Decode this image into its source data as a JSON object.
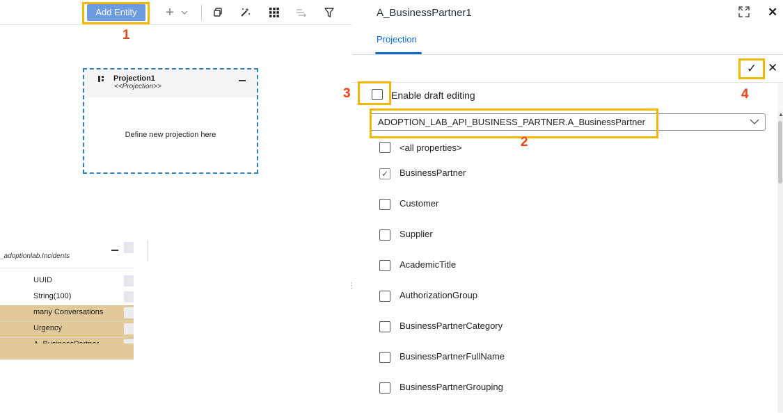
{
  "toolbar": {
    "add_entity_label": "Add Entity",
    "icons": [
      "plus-icon",
      "chevron-down-icon",
      "copy-icon",
      "magic-wand-icon",
      "grid-icon",
      "route-icon",
      "filter-icon"
    ]
  },
  "projection_node": {
    "title": "Projection1",
    "stereotype": "<<Projection>>",
    "placeholder": "Define new projection here"
  },
  "entity_node": {
    "title": "_adoptionlab.Incidents",
    "rows": [
      {
        "label": "UUID"
      },
      {
        "label": "String(100)"
      },
      {
        "label": "many Conversations"
      },
      {
        "label": "Urgency"
      },
      {
        "label": "A_BusinessPartner"
      }
    ]
  },
  "panel": {
    "title": "A_BusinessPartner1",
    "tab_label": "Projection",
    "confirm_symbol": "✓",
    "cancel_symbol": "✕",
    "close_symbol": "✕"
  },
  "form": {
    "draft_label": "Enable draft editing",
    "draft_checked": false,
    "selected_entity": "ADOPTION_LAB_API_BUSINESS_PARTNER.A_BusinessPartner",
    "properties": [
      {
        "label": "<all properties>",
        "checked": false
      },
      {
        "label": "BusinessPartner",
        "checked": true
      },
      {
        "label": "Customer",
        "checked": false
      },
      {
        "label": "Supplier",
        "checked": false
      },
      {
        "label": "AcademicTitle",
        "checked": false
      },
      {
        "label": "AuthorizationGroup",
        "checked": false
      },
      {
        "label": "BusinessPartnerCategory",
        "checked": false
      },
      {
        "label": "BusinessPartnerFullName",
        "checked": false
      },
      {
        "label": "BusinessPartnerGrouping",
        "checked": false
      }
    ]
  },
  "annotations": {
    "step1": "1",
    "step2": "2",
    "step3": "3",
    "step4": "4"
  },
  "colors": {
    "highlight_frame": "#f2b705",
    "step_marker": "#e8471b",
    "accent": "#0a6ed1",
    "add_button": "#6d9be0",
    "association_row": "#e2c99a"
  }
}
